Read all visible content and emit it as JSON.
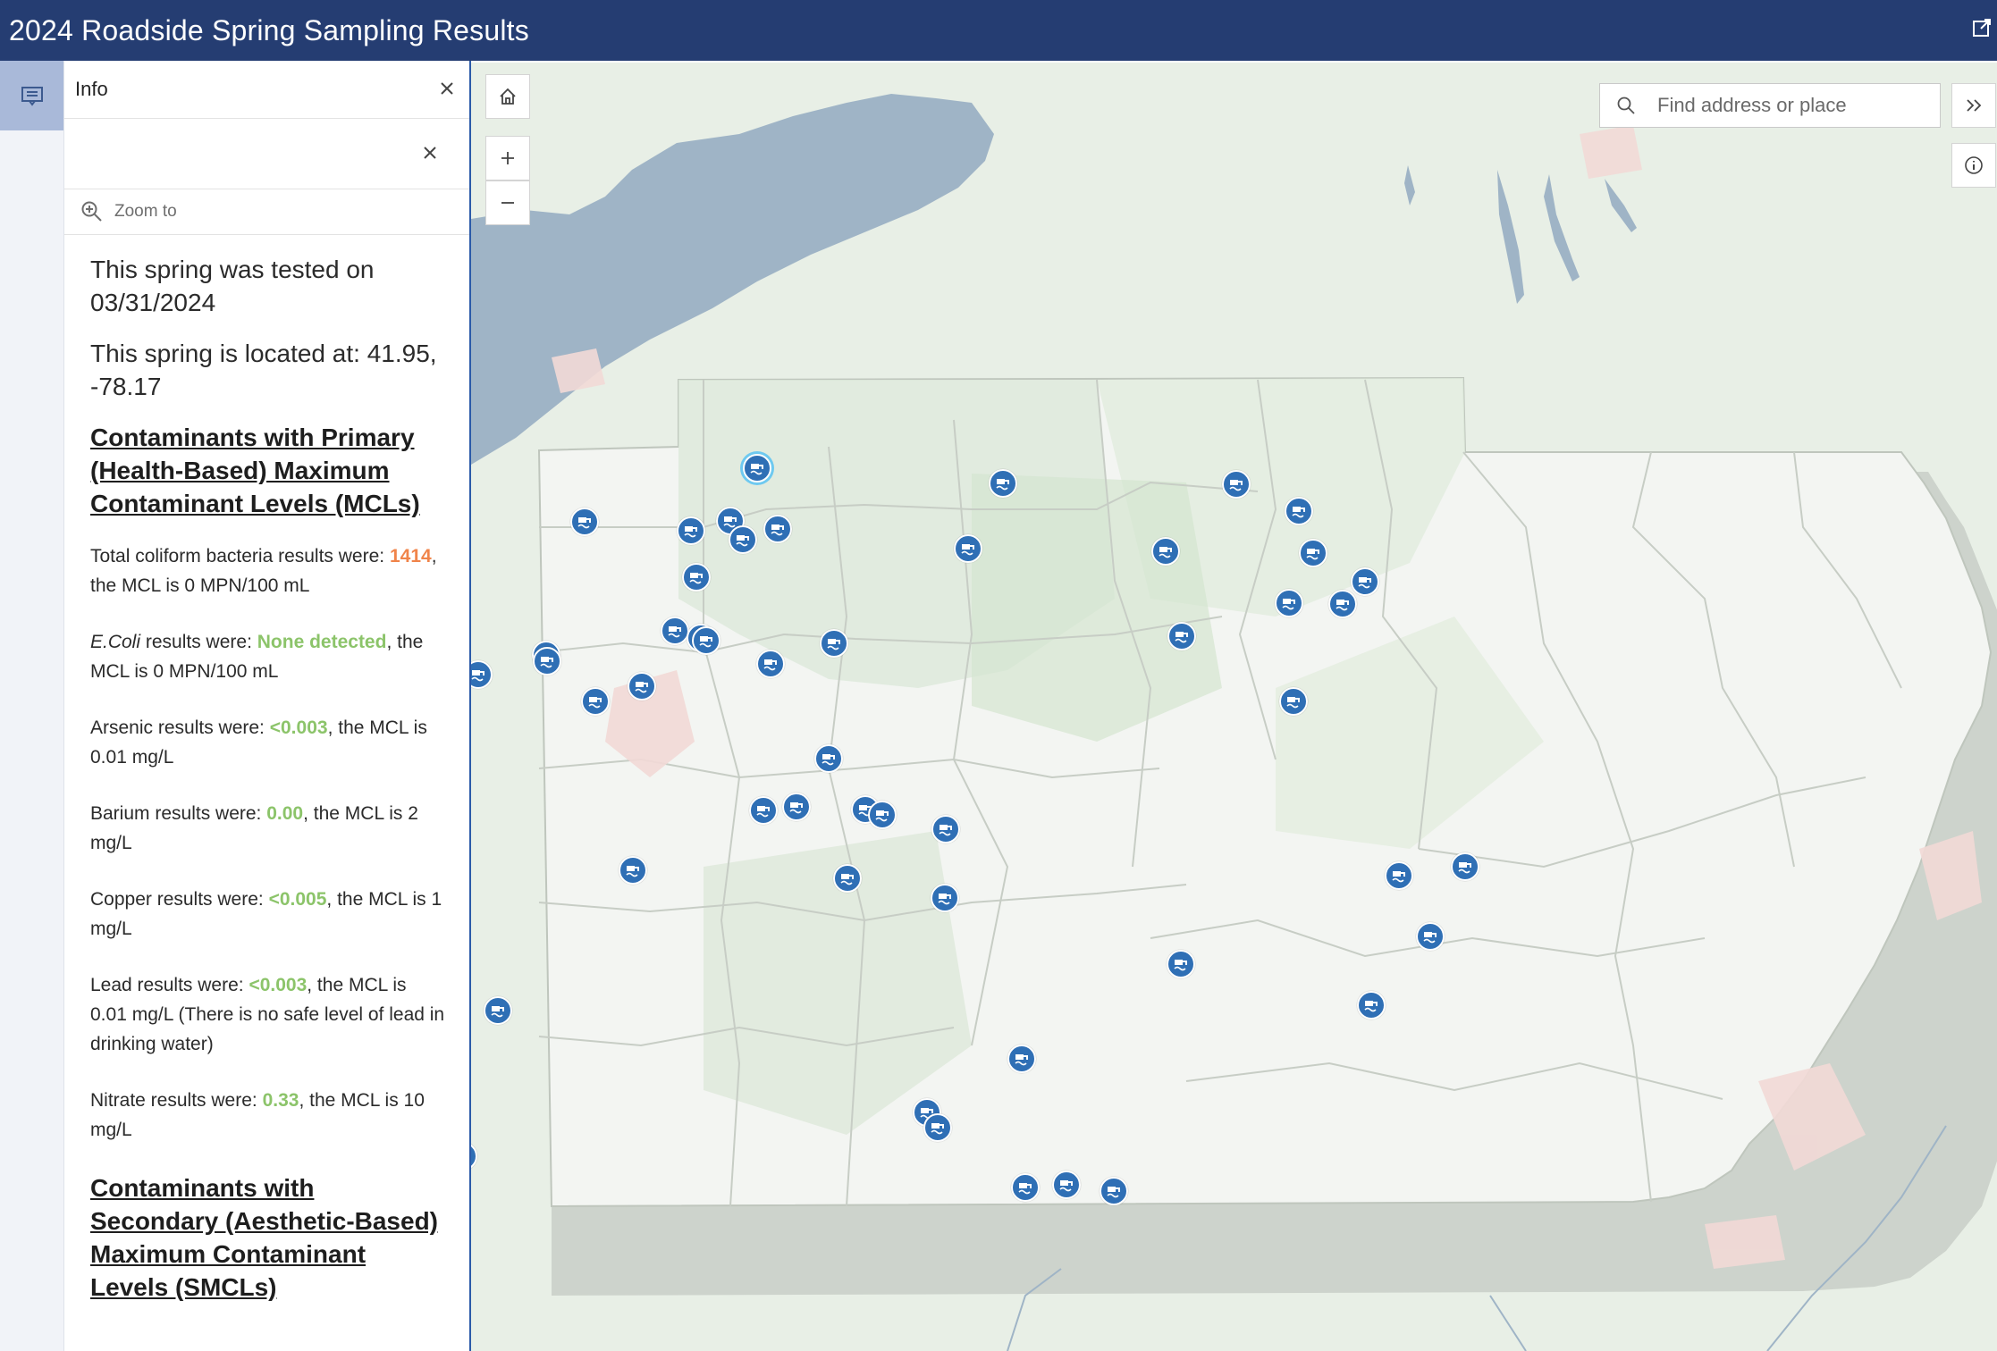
{
  "app": {
    "title": "2024 Roadside Spring Sampling Results"
  },
  "panel": {
    "title": "Info",
    "zoom_label": "Zoom to",
    "tested_text": "This spring was tested on 03/31/2024",
    "located_text": "This spring is located at: 41.95, -78.17",
    "primary_heading": "Contaminants with Primary (Health-Based) Maximum Contaminant Levels (MCLs)",
    "results": [
      {
        "pre": "Total coliform bacteria results were: ",
        "value": "1414",
        "post": ", the MCL is 0 MPN/100 mL",
        "status": "orange"
      },
      {
        "pre_italic": "E.Coli",
        "pre": " results were: ",
        "value": "None detected",
        "post": ", the MCL is 0 MPN/100 mL",
        "status": "green"
      },
      {
        "pre": "Arsenic results were: ",
        "value": "<0.003",
        "post": ", the MCL is 0.01 mg/L",
        "status": "green"
      },
      {
        "pre": "Barium results were: ",
        "value": "0.00",
        "post": ", the MCL is 2 mg/L",
        "status": "green"
      },
      {
        "pre": "Copper results were: ",
        "value": "<0.005",
        "post": ", the MCL is 1 mg/L",
        "status": "green"
      },
      {
        "pre": "Lead results were: ",
        "value": "<0.003",
        "post": ", the MCL is 0.01 mg/L (There is no safe level of lead in drinking water)",
        "status": "green"
      },
      {
        "pre": "Nitrate results were: ",
        "value": "0.33",
        "post": ", the MCL is 10 mg/L",
        "status": "green"
      }
    ],
    "secondary_heading": "Contaminants with Secondary (Aesthetic-Based) Maximum Contaminant Levels (SMCLs)"
  },
  "map": {
    "search_placeholder": "Find address or place",
    "colors": {
      "lake": "#9fb4c6",
      "marker": "#2f6fb5",
      "header": "#253d72",
      "exceed": "#f0844a",
      "ok": "#8cc46a"
    },
    "icons": [
      "home-icon",
      "zoom-in-icon",
      "zoom-out-icon",
      "search-icon",
      "expand-icon",
      "info-icon",
      "spring-marker-icon"
    ]
  }
}
